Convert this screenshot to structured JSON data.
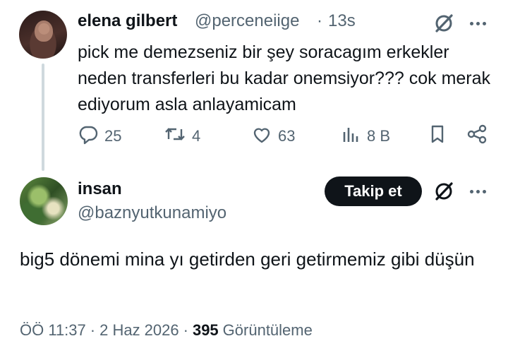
{
  "tweet1": {
    "name": "elena gilbert",
    "handle": "@perceneiige",
    "dot": "·",
    "time": "13s",
    "text": "pick me demezseniz bir şey soracagım erkekler neden transferleri bu kadar onemsiyor??? cok merak ediyorum asla anlayamicam",
    "actions": {
      "replies": "25",
      "retweets": "4",
      "likes": "63",
      "views": "8 B"
    }
  },
  "tweet2": {
    "name": "insan",
    "handle": "@baznyutkunamiyo",
    "follow_label": "Takip et",
    "text": "big5 dönemi mina yı getirden geri getirmemiz gibi düşün",
    "time": "ÖÖ 11:37",
    "date": "2 Haz 2026",
    "sep": "·",
    "views_count": "395",
    "views_label": "Görüntüleme"
  },
  "icons": [
    "grok-icon",
    "more-icon",
    "reply-icon",
    "retweet-icon",
    "like-icon",
    "views-icon",
    "bookmark-icon",
    "share-icon"
  ],
  "colors": {
    "text": "#0f1419",
    "secondary": "#536471",
    "thread": "#cfd9de",
    "button_bg": "#0f1419"
  }
}
